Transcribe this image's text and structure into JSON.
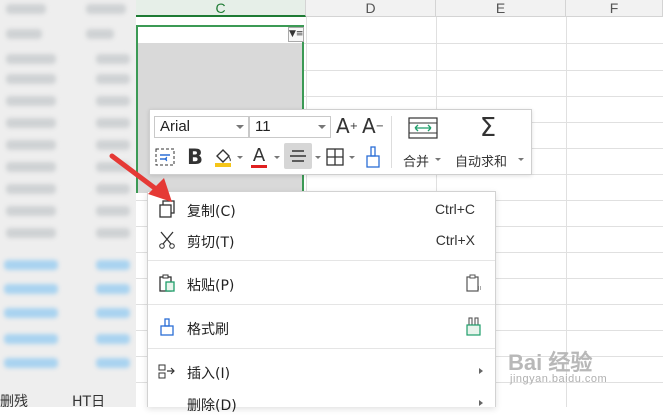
{
  "sheet": {
    "columns": [
      {
        "label": "C",
        "active": true
      },
      {
        "label": "D",
        "active": false
      },
      {
        "label": "E",
        "active": false
      },
      {
        "label": "F",
        "active": false
      }
    ],
    "bottom_left_text": "删残",
    "bottom_left_text2": "HT日"
  },
  "toolbar": {
    "font_name": "Arial",
    "font_size": "11",
    "merge_label": "合并",
    "autosum_label": "自动求和",
    "increase_font_icon": "A⁺",
    "decrease_font_icon": "A⁻",
    "bold_icon": "B",
    "font_color_icon": "A",
    "font_color": "#e02020",
    "fill_color": "#f5c518"
  },
  "menu": {
    "items": [
      {
        "label": "复制(C)",
        "shortcut": "Ctrl+C",
        "icon": "copy-icon"
      },
      {
        "label": "剪切(T)",
        "shortcut": "Ctrl+X",
        "icon": "cut-icon"
      },
      {
        "label": "粘贴(P)",
        "icon": "paste-icon"
      },
      {
        "label": "格式刷",
        "icon": "format-painter-icon"
      },
      {
        "label": "插入(I)",
        "icon": "insert-icon"
      },
      {
        "label": "删除(D)",
        "icon": "delete-icon"
      }
    ]
  },
  "watermark": {
    "brand": "Bai 经验",
    "url": "jingyan.baidu.com"
  },
  "colors": {
    "accent_green": "#1e7b34",
    "arrow_red": "#e53935"
  }
}
